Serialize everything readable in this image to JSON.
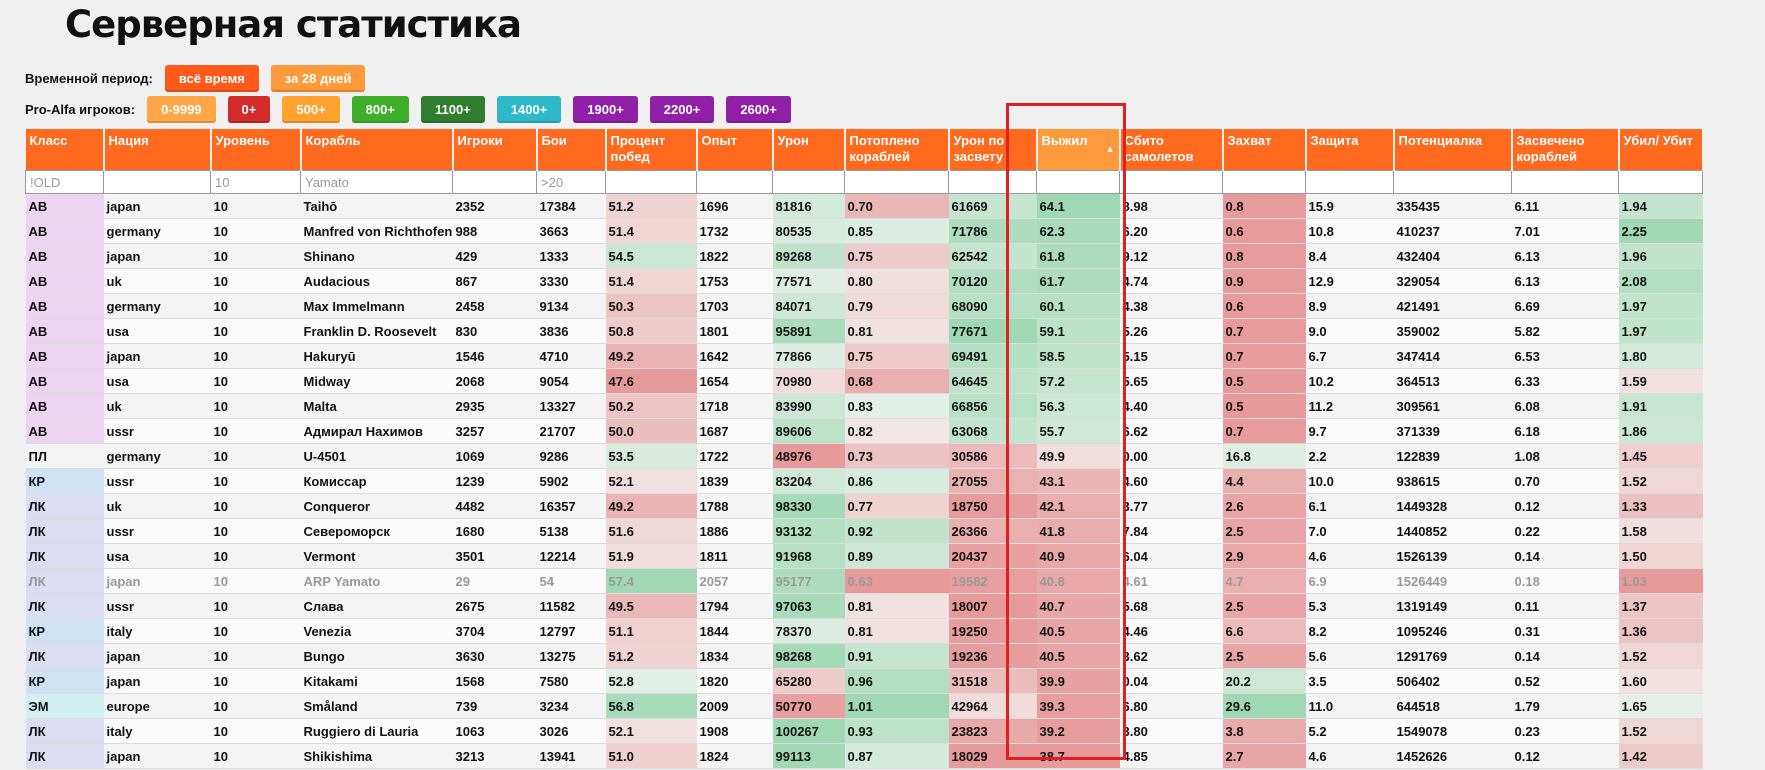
{
  "title": "Серверная статистика",
  "period": {
    "label": "Временной период:",
    "buttons": [
      {
        "label": "всё время",
        "color": "#ff5a1a"
      },
      {
        "label": "за 28 дней",
        "color": "#ff9a3c"
      }
    ]
  },
  "alfa": {
    "label": "Pro-Alfa игроков:",
    "buttons": [
      {
        "label": "0-9999",
        "color": "#ffa648"
      },
      {
        "label": "0+",
        "color": "#d32a2a"
      },
      {
        "label": "500+",
        "color": "#ffa22e"
      },
      {
        "label": "800+",
        "color": "#3fae2a"
      },
      {
        "label": "1100+",
        "color": "#2f7d2f"
      },
      {
        "label": "1400+",
        "color": "#2eb8c8"
      },
      {
        "label": "1900+",
        "color": "#9020a8"
      },
      {
        "label": "2200+",
        "color": "#9020a8"
      },
      {
        "label": "2600+",
        "color": "#9020a8"
      }
    ]
  },
  "columns": [
    {
      "label": "Класс",
      "width": 78
    },
    {
      "label": "Нация",
      "width": 107
    },
    {
      "label": "Уровень",
      "width": 90
    },
    {
      "label": "Корабль",
      "width": 152
    },
    {
      "label": "Игроки",
      "width": 84
    },
    {
      "label": "Бои",
      "width": 69
    },
    {
      "label": "Процент побед",
      "width": 91
    },
    {
      "label": "Опыт",
      "width": 76
    },
    {
      "label": "Урон",
      "width": 72
    },
    {
      "label": "Потоплено кораблей",
      "width": 104
    },
    {
      "label": "Урон по засвету",
      "width": 88
    },
    {
      "label": "Выжил",
      "width": 83,
      "active": true,
      "sort": "▲"
    },
    {
      "label": "Сбито самолетов",
      "width": 103
    },
    {
      "label": "Захват",
      "width": 83
    },
    {
      "label": "Защита",
      "width": 88
    },
    {
      "label": "Потенциалка",
      "width": 118
    },
    {
      "label": "Засвечено кораблей",
      "width": 107
    },
    {
      "label": "Убил/ Убит",
      "width": 84
    }
  ],
  "filters": [
    "!OLD",
    "",
    "10",
    "Yamato",
    "",
    ">20",
    "",
    "",
    "",
    "",
    "",
    "",
    "",
    "",
    "",
    "",
    "",
    ""
  ],
  "rows": [
    {
      "c": [
        "АВ",
        "japan",
        "10",
        "Taihō",
        "2352",
        "17384",
        "51.2",
        "1696",
        "81816",
        "0.70",
        "61669",
        "64.1",
        "8.98",
        "0.8",
        "15.9",
        "335435",
        "6.11",
        "1.94"
      ]
    },
    {
      "c": [
        "АВ",
        "germany",
        "10",
        "Manfred von Richthofen",
        "988",
        "3663",
        "51.4",
        "1732",
        "80535",
        "0.85",
        "71786",
        "62.3",
        "6.20",
        "0.6",
        "10.8",
        "410237",
        "7.01",
        "2.25"
      ]
    },
    {
      "c": [
        "АВ",
        "japan",
        "10",
        "Shinano",
        "429",
        "1333",
        "54.5",
        "1822",
        "89268",
        "0.75",
        "62542",
        "61.8",
        "9.12",
        "0.8",
        "8.4",
        "432404",
        "6.13",
        "1.96"
      ]
    },
    {
      "c": [
        "АВ",
        "uk",
        "10",
        "Audacious",
        "867",
        "3330",
        "51.4",
        "1753",
        "77571",
        "0.80",
        "70120",
        "61.7",
        "4.74",
        "0.9",
        "12.9",
        "329054",
        "6.13",
        "2.08"
      ]
    },
    {
      "c": [
        "АВ",
        "germany",
        "10",
        "Max Immelmann",
        "2458",
        "9134",
        "50.3",
        "1703",
        "84071",
        "0.79",
        "68090",
        "60.1",
        "4.38",
        "0.6",
        "8.9",
        "421491",
        "6.69",
        "1.97"
      ]
    },
    {
      "c": [
        "АВ",
        "usa",
        "10",
        "Franklin D. Roosevelt",
        "830",
        "3836",
        "50.8",
        "1801",
        "95891",
        "0.81",
        "77671",
        "59.1",
        "5.26",
        "0.7",
        "9.0",
        "359002",
        "5.82",
        "1.97"
      ]
    },
    {
      "c": [
        "АВ",
        "japan",
        "10",
        "Hakuryū",
        "1546",
        "4710",
        "49.2",
        "1642",
        "77866",
        "0.75",
        "69491",
        "58.5",
        "5.15",
        "0.7",
        "6.7",
        "347414",
        "6.53",
        "1.80"
      ]
    },
    {
      "c": [
        "АВ",
        "usa",
        "10",
        "Midway",
        "2068",
        "9054",
        "47.6",
        "1654",
        "70980",
        "0.68",
        "64645",
        "57.2",
        "5.65",
        "0.5",
        "10.2",
        "364513",
        "6.33",
        "1.59"
      ]
    },
    {
      "c": [
        "АВ",
        "uk",
        "10",
        "Malta",
        "2935",
        "13327",
        "50.2",
        "1718",
        "83990",
        "0.83",
        "66856",
        "56.3",
        "4.40",
        "0.5",
        "11.2",
        "309561",
        "6.08",
        "1.91"
      ]
    },
    {
      "c": [
        "АВ",
        "ussr",
        "10",
        "Адмирал Нахимов",
        "3257",
        "21707",
        "50.0",
        "1687",
        "89606",
        "0.82",
        "63068",
        "55.7",
        "6.62",
        "0.7",
        "9.7",
        "371339",
        "6.18",
        "1.86"
      ]
    },
    {
      "c": [
        "ПЛ",
        "germany",
        "10",
        "U-4501",
        "1069",
        "9286",
        "53.5",
        "1722",
        "48976",
        "0.73",
        "30586",
        "49.9",
        "0.00",
        "16.8",
        "2.2",
        "122839",
        "1.08",
        "1.45"
      ]
    },
    {
      "c": [
        "КР",
        "ussr",
        "10",
        "Комиссар",
        "1239",
        "5902",
        "52.1",
        "1839",
        "83204",
        "0.86",
        "27055",
        "43.1",
        "4.60",
        "4.4",
        "10.0",
        "938615",
        "0.70",
        "1.52"
      ]
    },
    {
      "c": [
        "ЛК",
        "uk",
        "10",
        "Conqueror",
        "4482",
        "16357",
        "49.2",
        "1788",
        "98330",
        "0.77",
        "18750",
        "42.1",
        "3.77",
        "2.6",
        "6.1",
        "1449328",
        "0.12",
        "1.33"
      ]
    },
    {
      "c": [
        "ЛК",
        "ussr",
        "10",
        "Североморск",
        "1680",
        "5138",
        "51.6",
        "1886",
        "93132",
        "0.92",
        "26366",
        "41.8",
        "7.84",
        "2.5",
        "7.0",
        "1440852",
        "0.22",
        "1.58"
      ]
    },
    {
      "c": [
        "ЛК",
        "usa",
        "10",
        "Vermont",
        "3501",
        "12214",
        "51.9",
        "1811",
        "91968",
        "0.89",
        "20437",
        "40.9",
        "6.04",
        "2.9",
        "4.6",
        "1526139",
        "0.14",
        "1.50"
      ]
    },
    {
      "dim": true,
      "c": [
        "ЛК",
        "japan",
        "10",
        "ARP Yamato",
        "29",
        "54",
        "57.4",
        "2057",
        "95177",
        "0.63",
        "19582",
        "40.8",
        "4.61",
        "4.7",
        "6.9",
        "1526449",
        "0.18",
        "1.03"
      ]
    },
    {
      "c": [
        "ЛК",
        "ussr",
        "10",
        "Слава",
        "2675",
        "11582",
        "49.5",
        "1794",
        "97063",
        "0.81",
        "18007",
        "40.7",
        "5.68",
        "2.5",
        "5.3",
        "1319149",
        "0.11",
        "1.37"
      ]
    },
    {
      "c": [
        "КР",
        "italy",
        "10",
        "Venezia",
        "3704",
        "12797",
        "51.1",
        "1844",
        "78370",
        "0.81",
        "19250",
        "40.5",
        "4.46",
        "6.6",
        "8.2",
        "1095246",
        "0.31",
        "1.36"
      ]
    },
    {
      "c": [
        "ЛК",
        "japan",
        "10",
        "Bungo",
        "3630",
        "13275",
        "51.2",
        "1834",
        "98268",
        "0.91",
        "19236",
        "40.5",
        "3.62",
        "2.5",
        "5.6",
        "1291769",
        "0.14",
        "1.52"
      ]
    },
    {
      "c": [
        "КР",
        "japan",
        "10",
        "Kitakami",
        "1568",
        "7580",
        "52.8",
        "1820",
        "65280",
        "0.96",
        "31518",
        "39.9",
        "0.04",
        "20.2",
        "3.5",
        "506402",
        "0.52",
        "1.60"
      ]
    },
    {
      "c": [
        "ЭМ",
        "europe",
        "10",
        "Småland",
        "739",
        "3234",
        "56.8",
        "2009",
        "50770",
        "1.01",
        "42964",
        "39.3",
        "6.80",
        "29.6",
        "11.0",
        "644518",
        "1.79",
        "1.65"
      ]
    },
    {
      "c": [
        "ЛК",
        "italy",
        "10",
        "Ruggiero di Lauria",
        "1063",
        "3026",
        "52.1",
        "1908",
        "100267",
        "0.93",
        "23823",
        "39.2",
        "3.80",
        "3.8",
        "5.2",
        "1549078",
        "0.23",
        "1.52"
      ]
    },
    {
      "c": [
        "ЛК",
        "japan",
        "10",
        "Shikishima",
        "3213",
        "13941",
        "51.0",
        "1824",
        "99113",
        "0.87",
        "18029",
        "38.7",
        "4.85",
        "2.7",
        "4.6",
        "1452626",
        "0.12",
        "1.42"
      ]
    }
  ],
  "class_colors": {
    "АВ": "#ecd4f2",
    "ПЛ": "#f4f4f4",
    "КР": "#cfe2f3",
    "ЛК": "#dcdcf2",
    "ЭМ": "#d2f0f0"
  },
  "heat_good": "#9fd8b3",
  "heat_bad": "#e79a9a"
}
